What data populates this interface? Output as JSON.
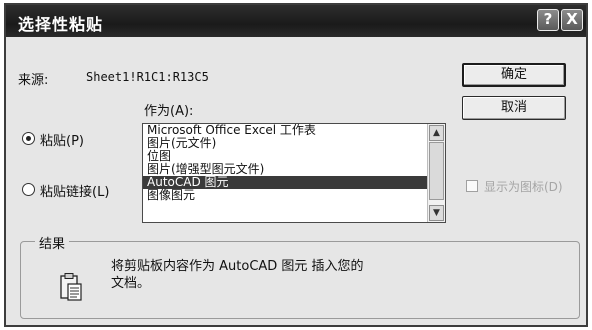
{
  "dialog": {
    "title": "选择性粘贴",
    "help_button": "?",
    "close_button": "X"
  },
  "source": {
    "label": "来源:",
    "value": "Sheet1!R1C1:R13C5"
  },
  "as_label": "作为(A):",
  "options": {
    "paste_label": "粘贴(P)",
    "paste_link_label": "粘贴链接(L)",
    "selected": "paste"
  },
  "list": {
    "items": [
      "Microsoft Office Excel 工作表",
      "图片(元文件)",
      "位图",
      "图片(增强型图元文件)",
      "AutoCAD 图元",
      "图像图元"
    ],
    "selected_index": 4
  },
  "buttons": {
    "ok": "确定",
    "cancel": "取消"
  },
  "display_as_icon": {
    "label": "显示为图标(D)",
    "checked": false
  },
  "result": {
    "legend": "结果",
    "text_line1": "将剪贴板内容作为 AutoCAD 图元 插入您的",
    "text_line2": "文档。"
  },
  "icons": {
    "result": "clipboard-icon"
  }
}
